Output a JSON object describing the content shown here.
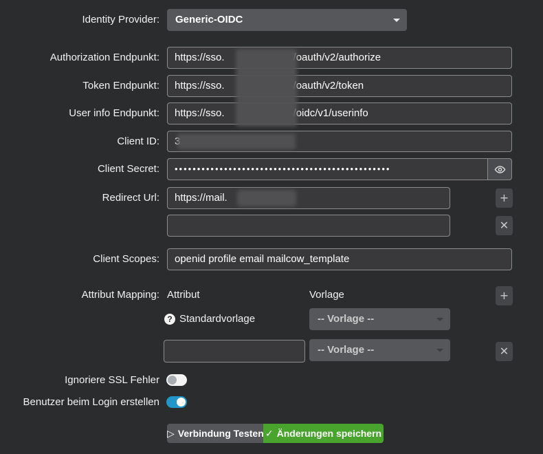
{
  "form": {
    "identity_provider": {
      "label": "Identity Provider:",
      "value": "Generic-OIDC"
    },
    "endpoints": [
      {
        "label": "Authorization Endpunkt:",
        "prefix": "https://sso.",
        "suffix": "/oauth/v2/authorize"
      },
      {
        "label": "Token Endpunkt:",
        "prefix": "https://sso.",
        "suffix": "/oauth/v2/token"
      },
      {
        "label": "User info Endpunkt:",
        "prefix": "https://sso.",
        "suffix": "/oidc/v1/userinfo"
      }
    ],
    "client_id": {
      "label": "Client ID:",
      "visible_value": "3"
    },
    "client_secret": {
      "label": "Client Secret:",
      "masked_value": "••••••••••••••••••••••••••••••••••••••••••••••••"
    },
    "redirect_url": {
      "label": "Redirect Url:",
      "visible_value": "https://mail.",
      "second_value": ""
    },
    "client_scopes": {
      "label": "Client Scopes:",
      "value": "openid profile email mailcow_template"
    },
    "attribute_mapping": {
      "label": "Attribut Mapping:",
      "attribute_header": "Attribut",
      "template_header": "Vorlage",
      "rows": [
        {
          "attribute_label": "Standardvorlage",
          "template_value": "-- Vorlage --"
        },
        {
          "attribute_value": "",
          "template_value": "-- Vorlage --"
        }
      ]
    },
    "ignore_ssl": {
      "label": "Ignoriere SSL Fehler",
      "state": "off"
    },
    "create_user_on_login": {
      "label": "Benutzer beim Login erstellen",
      "state": "on"
    },
    "actions": {
      "test_label": "Verbindung Testen",
      "save_label": "Änderungen speichern"
    }
  },
  "icons": {
    "plus": "+",
    "close": "✕",
    "question": "?",
    "play": "▷",
    "check": "✓"
  },
  "colors": {
    "page_background": "#2b2c2e",
    "input_background": "#39393b",
    "input_border": "#8c8c8c",
    "select_background": "#55575a",
    "save_green": "#48a42c",
    "toggle_on_blue": "#2396c9",
    "toggle_off_track": "#f4f4f4"
  }
}
